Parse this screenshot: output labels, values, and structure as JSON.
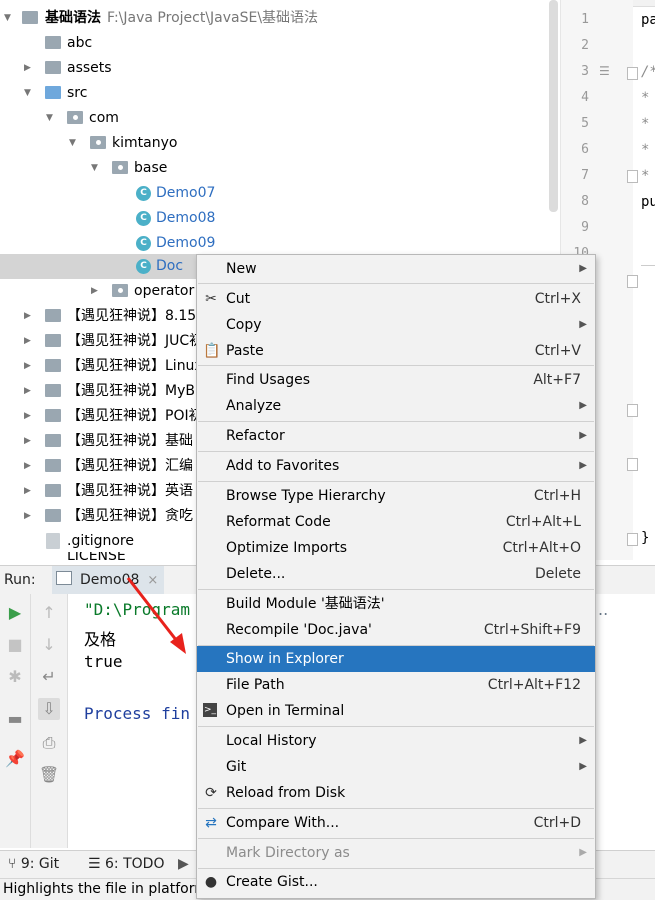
{
  "tree": {
    "root": {
      "name": "基础语法",
      "path": "F:\\Java Project\\JavaSE\\基础语法"
    },
    "items": [
      {
        "label": "abc"
      },
      {
        "label": "assets"
      },
      {
        "label": "src"
      },
      {
        "label": "com"
      },
      {
        "label": "kimtanyo"
      },
      {
        "label": "base"
      },
      {
        "label": "Demo07"
      },
      {
        "label": "Demo08"
      },
      {
        "label": "Demo09"
      },
      {
        "label": "Doc"
      },
      {
        "label": "operator"
      },
      {
        "label": "【遇见狂神说】8.15祁"
      },
      {
        "label": "【遇见狂神说】JUC初"
      },
      {
        "label": "【遇见狂神说】Linux"
      },
      {
        "label": "【遇见狂神说】MyB"
      },
      {
        "label": "【遇见狂神说】POI初"
      },
      {
        "label": "【遇见狂神说】基础"
      },
      {
        "label": "【遇见狂神说】汇编"
      },
      {
        "label": "【遇见狂神说】英语"
      },
      {
        "label": "【遇见狂神说】贪吃"
      },
      {
        "label": ".gitignore"
      },
      {
        "label": "LICENSE"
      }
    ]
  },
  "editor": {
    "line_numbers": [
      "1",
      "2",
      "3",
      "4",
      "5",
      "6",
      "7",
      "8",
      "9",
      "10"
    ],
    "code": {
      "l1": "pa",
      "l3": "/*",
      "l8": "pu",
      "close": "}"
    }
  },
  "run": {
    "label": "Run:",
    "tab": "Demo08",
    "close": "×",
    "console": [
      "\"D:\\Program",
      "及格",
      "true",
      "",
      "Process fin"
    ]
  },
  "toolbar": {
    "git": "9: Git",
    "todo": "6: TODO"
  },
  "status": {
    "text": "Highlights the file in platform"
  },
  "menu": {
    "items": [
      {
        "label": "New",
        "shortcut": "",
        "sub": true
      },
      {
        "label": "Cut",
        "shortcut": "Ctrl+X",
        "icon": "scissors-icon"
      },
      {
        "label": "Copy",
        "shortcut": "",
        "sub": true
      },
      {
        "label": "Paste",
        "shortcut": "Ctrl+V",
        "icon": "clipboard-icon"
      },
      {
        "label": "Find Usages",
        "shortcut": "Alt+F7"
      },
      {
        "label": "Analyze",
        "shortcut": "",
        "sub": true
      },
      {
        "label": "Refactor",
        "shortcut": "",
        "sub": true
      },
      {
        "label": "Add to Favorites",
        "shortcut": "",
        "sub": true
      },
      {
        "label": "Browse Type Hierarchy",
        "shortcut": "Ctrl+H"
      },
      {
        "label": "Reformat Code",
        "shortcut": "Ctrl+Alt+L"
      },
      {
        "label": "Optimize Imports",
        "shortcut": "Ctrl+Alt+O"
      },
      {
        "label": "Delete...",
        "shortcut": "Delete"
      },
      {
        "label": "Build Module '基础语法'",
        "shortcut": ""
      },
      {
        "label": "Recompile 'Doc.java'",
        "shortcut": "Ctrl+Shift+F9"
      },
      {
        "label": "Show in Explorer",
        "shortcut": ""
      },
      {
        "label": "File Path",
        "shortcut": "Ctrl+Alt+F12"
      },
      {
        "label": "Open in Terminal",
        "shortcut": "",
        "icon": "terminal-icon"
      },
      {
        "label": "Local History",
        "shortcut": "",
        "sub": true
      },
      {
        "label": "Git",
        "shortcut": "",
        "sub": true
      },
      {
        "label": "Reload from Disk",
        "shortcut": "",
        "icon": "reload-icon"
      },
      {
        "label": "Compare With...",
        "shortcut": "Ctrl+D",
        "icon": "compare-icon"
      },
      {
        "label": "Mark Directory as",
        "shortcut": "",
        "sub": true,
        "disabled": true
      },
      {
        "label": "Create Gist...",
        "shortcut": "",
        "icon": "github-icon"
      }
    ]
  },
  "colors": {
    "highlight": "#2675bf",
    "annotation_arrow": "#e8221c"
  }
}
